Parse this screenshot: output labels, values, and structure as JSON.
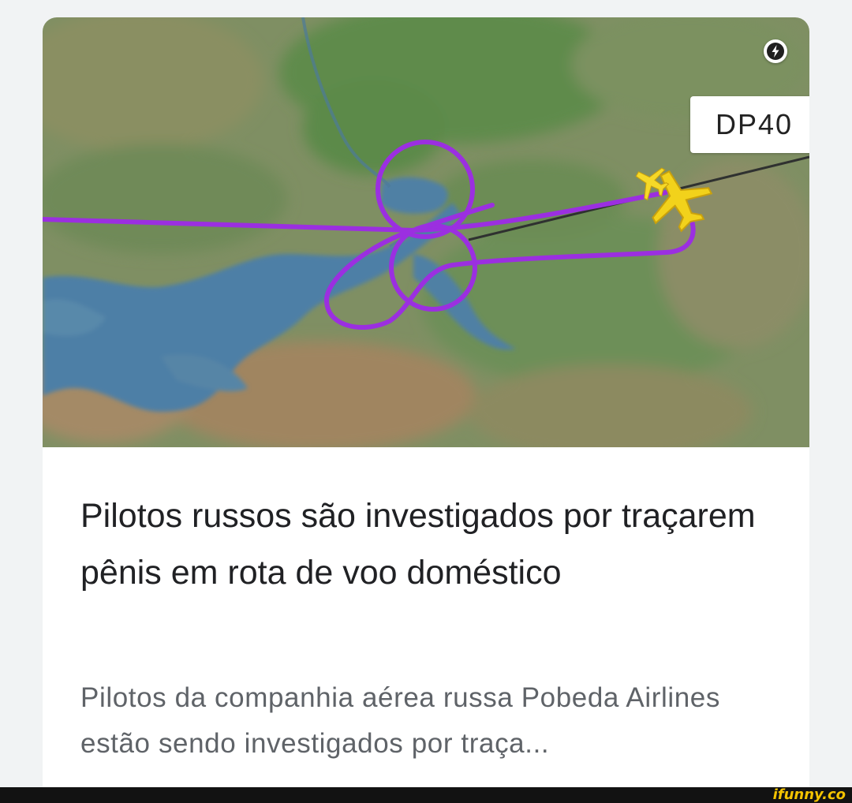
{
  "article_card": {
    "image": {
      "flight_label": "DP40",
      "icon": "amp-lightning-icon",
      "route_color": "#9b2fe0",
      "plane_color": "#f2d21b"
    },
    "headline": "Pilotos russos são investigados por traçarem pênis em rota de voo doméstico",
    "snippet": "Pilotos da companhia aérea russa Pobeda Airlines estão sendo investigados por traça..."
  },
  "footer": {
    "watermark": "ifunny.co"
  }
}
